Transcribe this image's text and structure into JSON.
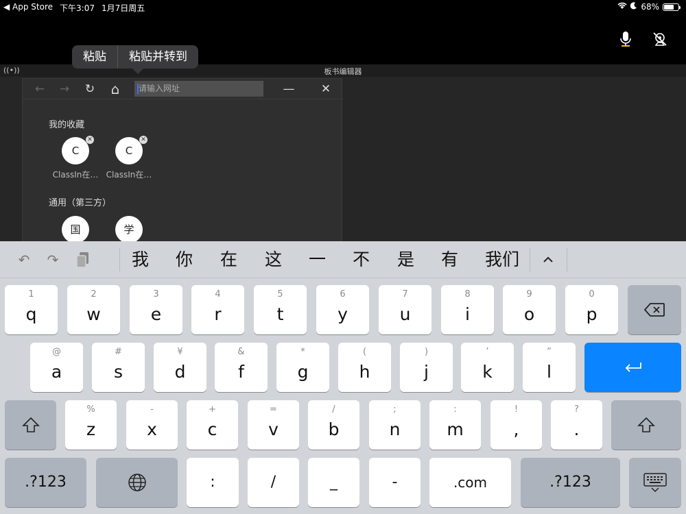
{
  "status_bar": {
    "back_app": "◀ App Store",
    "time": "下午3:07",
    "date": "1月7日周五",
    "battery": "68%",
    "battery_level": 0.68
  },
  "paste_menu": {
    "paste": "粘贴",
    "paste_and_go": "粘贴并转到"
  },
  "board": {
    "title": "板书编辑器",
    "broadcast_icon": "((•))"
  },
  "browser": {
    "back": "←",
    "forward": "→",
    "refresh": "↻",
    "home": "⌂",
    "url_placeholder": "请输入网址",
    "minimize": "—",
    "close": "✕",
    "favorites_title": "我的收藏",
    "favorites": [
      {
        "letter": "C",
        "label": "ClassIn在…"
      },
      {
        "letter": "C",
        "label": "ClassIn在…"
      }
    ],
    "general_title": "通用（第三方）",
    "general": [
      {
        "letter": "国"
      },
      {
        "letter": "学"
      }
    ]
  },
  "keyboard": {
    "undo": "↶",
    "redo": "↷",
    "paste": "📋",
    "candidates": [
      "我",
      "你",
      "在",
      "这",
      "一",
      "不",
      "是",
      "有",
      "我们"
    ],
    "collapse": "^",
    "row1": [
      {
        "sub": "1",
        "main": "q"
      },
      {
        "sub": "2",
        "main": "w"
      },
      {
        "sub": "3",
        "main": "e"
      },
      {
        "sub": "4",
        "main": "r"
      },
      {
        "sub": "5",
        "main": "t"
      },
      {
        "sub": "6",
        "main": "y"
      },
      {
        "sub": "7",
        "main": "u"
      },
      {
        "sub": "8",
        "main": "i"
      },
      {
        "sub": "9",
        "main": "o"
      },
      {
        "sub": "0",
        "main": "p"
      }
    ],
    "row2": [
      {
        "sub": "@",
        "main": "a"
      },
      {
        "sub": "#",
        "main": "s"
      },
      {
        "sub": "¥",
        "main": "d"
      },
      {
        "sub": "&",
        "main": "f"
      },
      {
        "sub": "*",
        "main": "g"
      },
      {
        "sub": "(",
        "main": "h"
      },
      {
        "sub": ")",
        "main": "j"
      },
      {
        "sub": "’",
        "main": "k"
      },
      {
        "sub": "”",
        "main": "l"
      }
    ],
    "row3": [
      {
        "sub": "%",
        "main": "z"
      },
      {
        "sub": "-",
        "main": "x"
      },
      {
        "sub": "+",
        "main": "c"
      },
      {
        "sub": "=",
        "main": "v"
      },
      {
        "sub": "/",
        "main": "b"
      },
      {
        "sub": ";",
        "main": "n"
      },
      {
        "sub": ":",
        "main": "m"
      },
      {
        "sub": "!",
        "main": ","
      },
      {
        "sub": "?",
        "main": "."
      }
    ],
    "row4": {
      "num_left": ".?123",
      "colon": ":",
      "slash": "/",
      "underscore": "_",
      "dash": "-",
      "dotcom": ".com",
      "num_right": ".?123"
    }
  }
}
